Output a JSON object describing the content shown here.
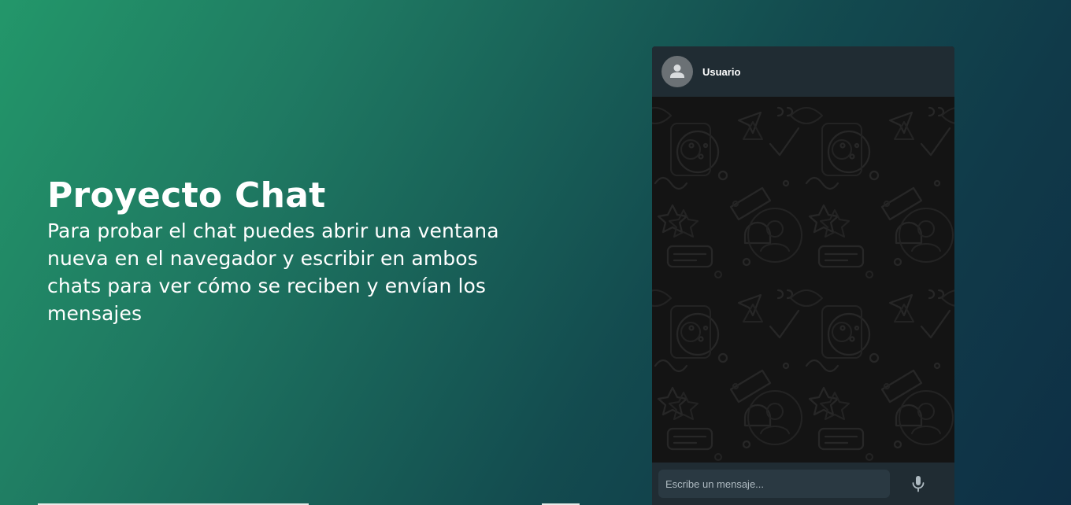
{
  "intro": {
    "title": "Proyecto Chat",
    "description": "Para probar el chat puedes abrir una ventana nueva en el navegador y escribir en ambos chats para ver cómo se reciben y envían los mensajes"
  },
  "chat": {
    "header": {
      "username": "Usuario",
      "avatar_icon": "person-icon"
    },
    "composer": {
      "placeholder": "Escribe un mensaje...",
      "value": "",
      "mic_icon": "microphone-icon"
    }
  },
  "colors": {
    "gradient_start": "#23976a",
    "gradient_end": "#0e2f45",
    "chat_header_bg": "#202c33",
    "chat_body_bg": "#141414",
    "input_bg": "#2a3942"
  }
}
